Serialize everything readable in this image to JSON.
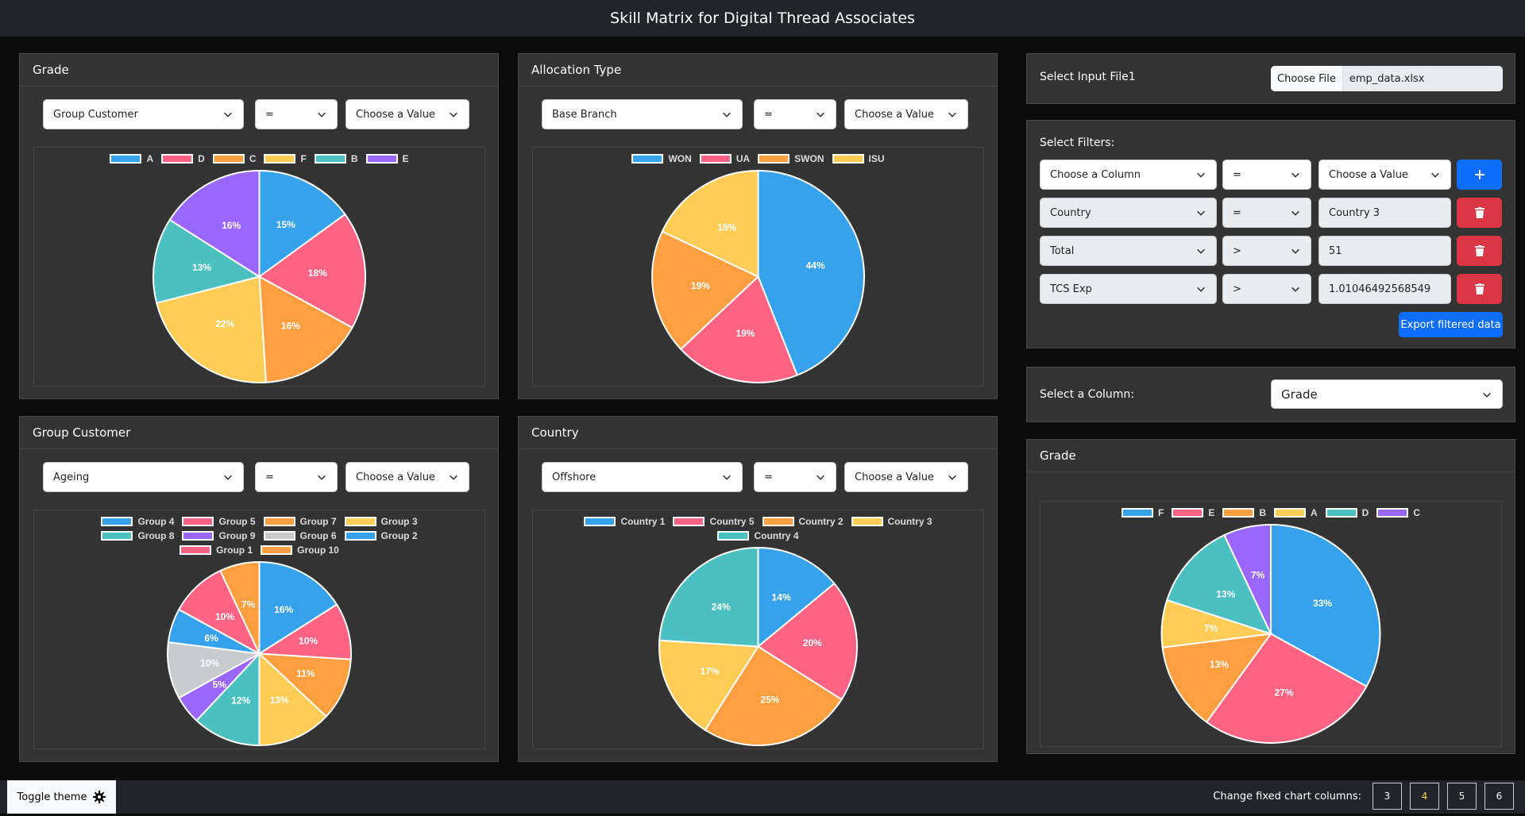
{
  "app": {
    "title": "Skill Matrix for Digital Thread Associates"
  },
  "cards": [
    {
      "filter": {
        "column": "Group Customer",
        "op": "=",
        "value": "Choose a Value"
      }
    },
    {
      "filter": {
        "column": "Base Branch",
        "op": "=",
        "value": "Choose a Value"
      }
    },
    {
      "filter": {
        "column": "Ageing",
        "op": "=",
        "value": "Choose a Value"
      }
    },
    {
      "filter": {
        "column": "Offshore",
        "op": "=",
        "value": "Choose a Value"
      }
    }
  ],
  "input_file": {
    "label": "Select Input File1",
    "button": "Choose File",
    "filename": "emp_data.xlsx"
  },
  "filters": {
    "label": "Select Filters:",
    "new_row": {
      "column": "Choose a Column",
      "op": "=",
      "value": "Choose a Value"
    },
    "rows": [
      {
        "column": "Country",
        "op": "=",
        "value": "Country 3"
      },
      {
        "column": "Total",
        "op": ">",
        "value": "51"
      },
      {
        "column": "TCS Exp",
        "op": ">",
        "value": "1.01046492568549"
      }
    ],
    "add_icon": "plus-icon",
    "delete_icon": "trash-icon",
    "export_label": "Export filtered data"
  },
  "column_select": {
    "label": "Select a Column:",
    "value": "Grade"
  },
  "footer": {
    "toggle_label": "Toggle theme",
    "toggle_icon": "gear-icon",
    "columns_label": "Change fixed chart columns:",
    "columns": [
      "3",
      "4",
      "5",
      "6"
    ],
    "active_column": "4"
  },
  "colors": {
    "accent": "#0d6efd",
    "danger": "#dc3545",
    "palette": [
      "#36a2eb",
      "#ff6384",
      "#ff9f40",
      "#ffcd56",
      "#4bc0c0",
      "#9966ff",
      "#c9cbcf"
    ]
  },
  "chart_data": [
    {
      "type": "pie",
      "title": "Grade",
      "labels": [
        "A",
        "D",
        "C",
        "F",
        "B",
        "E"
      ],
      "values": [
        15,
        18,
        16,
        22,
        13,
        16
      ],
      "colors": [
        "#36a2eb",
        "#ff6384",
        "#ff9f40",
        "#ffcd56",
        "#4bc0c0",
        "#9966ff"
      ],
      "legend": "top"
    },
    {
      "type": "pie",
      "title": "Allocation Type",
      "labels": [
        "WON",
        "UA",
        "SWON",
        "ISU"
      ],
      "values": [
        44,
        19,
        19,
        18
      ],
      "colors": [
        "#36a2eb",
        "#ff6384",
        "#ff9f40",
        "#ffcd56"
      ],
      "legend": "top"
    },
    {
      "type": "pie",
      "title": "Group Customer",
      "labels": [
        "Group 4",
        "Group 5",
        "Group 7",
        "Group 3",
        "Group 8",
        "Group 9",
        "Group 6",
        "Group 2",
        "Group 1",
        "Group 10"
      ],
      "values": [
        16,
        10,
        11,
        13,
        12,
        5,
        10,
        6,
        10,
        7
      ],
      "colors": [
        "#36a2eb",
        "#ff6384",
        "#ff9f40",
        "#ffcd56",
        "#4bc0c0",
        "#9966ff",
        "#c9cbcf",
        "#36a2eb",
        "#ff6384",
        "#ff9f40"
      ],
      "legend": "top"
    },
    {
      "type": "pie",
      "title": "Country",
      "labels": [
        "Country 1",
        "Country 5",
        "Country 2",
        "Country 3",
        "Country 4"
      ],
      "values": [
        14,
        20,
        25,
        17,
        24
      ],
      "colors": [
        "#36a2eb",
        "#ff6384",
        "#ff9f40",
        "#ffcd56",
        "#4bc0c0"
      ],
      "legend": "top"
    },
    {
      "type": "pie",
      "title": "Grade",
      "labels": [
        "F",
        "E",
        "B",
        "A",
        "D",
        "C"
      ],
      "values": [
        33,
        27,
        13,
        7,
        13,
        7
      ],
      "colors": [
        "#36a2eb",
        "#ff6384",
        "#ff9f40",
        "#ffcd56",
        "#4bc0c0",
        "#9966ff"
      ],
      "legend": "top"
    }
  ]
}
